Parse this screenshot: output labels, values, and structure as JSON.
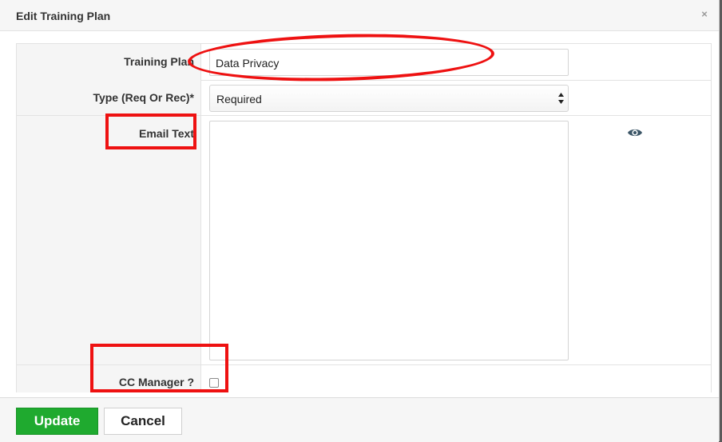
{
  "modal": {
    "title": "Edit Training Plan",
    "close_glyph": "×",
    "close_icon": "close-icon"
  },
  "form": {
    "training_plan": {
      "label": "Training Plan",
      "value": "Data Privacy"
    },
    "type": {
      "label": "Type (Req Or Rec)*",
      "selected": "Required",
      "icon": "select-arrows-icon"
    },
    "email_text": {
      "label": "Email Text",
      "value": "",
      "preview_icon": "eye-icon"
    },
    "cc_manager": {
      "label": "CC Manager ?",
      "checked": false
    }
  },
  "footer": {
    "update_label": "Update",
    "cancel_label": "Cancel"
  },
  "colors": {
    "annotation": "#ee1111",
    "update_button": "#1faa2f",
    "eye_icon": "#3c5667"
  }
}
